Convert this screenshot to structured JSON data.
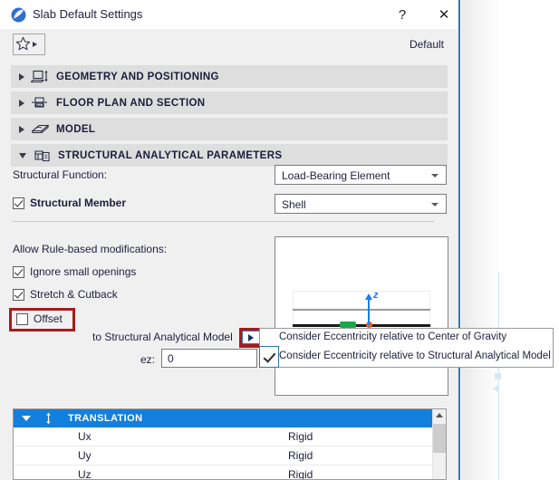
{
  "window": {
    "title": "Slab Default Settings",
    "app_icon": "archicad-slab-icon",
    "help_label": "?",
    "close_label": "✕"
  },
  "toolbar": {
    "favorites_icon": "star-icon",
    "favorites_caret": "caret-right-icon",
    "default_label": "Default"
  },
  "sections": [
    {
      "label": "GEOMETRY AND POSITIONING",
      "icon": "geometry-positioning-icon",
      "expanded": false
    },
    {
      "label": "FLOOR PLAN AND SECTION",
      "icon": "floor-plan-section-icon",
      "expanded": false
    },
    {
      "label": "MODEL",
      "icon": "model-icon",
      "expanded": false
    },
    {
      "label": "STRUCTURAL ANALYTICAL PARAMETERS",
      "icon": "structural-analytical-icon",
      "expanded": true
    }
  ],
  "structural": {
    "function_label": "Structural Function:",
    "function_value": "Load-Bearing Element",
    "member_label": "Structural Member",
    "member_checked": true,
    "member_value": "Shell",
    "rules_label": "Allow Rule-based modifications:",
    "rules": [
      {
        "label": "Ignore small openings",
        "checked": true
      },
      {
        "label": "Stretch & Cutback",
        "checked": true
      },
      {
        "label": "Offset",
        "checked": false
      }
    ],
    "to_model_label": "to Structural Analytical Model",
    "eccentricity_arrow_icon": "caret-right-icon",
    "ez_label": "ez:",
    "ez_value": "0"
  },
  "popup": {
    "items": [
      {
        "label": "Consider Eccentricity relative to Center of Gravity",
        "checked": false
      },
      {
        "label": "Consider Eccentricity relative to Structural Analytical Model",
        "checked": true
      }
    ]
  },
  "preview": {
    "axis_label": "z",
    "axis_color": "#1f7de8",
    "node_color": "#f25c22",
    "support_color": "#19a84c"
  },
  "table": {
    "group_label": "TRANSLATION",
    "group_icon": "translation-arrows-icon",
    "group_caret": "caret-down-icon",
    "rows": [
      {
        "name": "Ux",
        "value": "Rigid"
      },
      {
        "name": "Uy",
        "value": "Rigid"
      },
      {
        "name": "Uz",
        "value": "Rigid"
      }
    ],
    "scroll_up_icon": "chevron-up-icon"
  },
  "colors": {
    "accent": "#1280dc",
    "highlight_red": "#a81b1b",
    "dialog_border": "#2b76b9",
    "section_bg": "#dedede"
  }
}
